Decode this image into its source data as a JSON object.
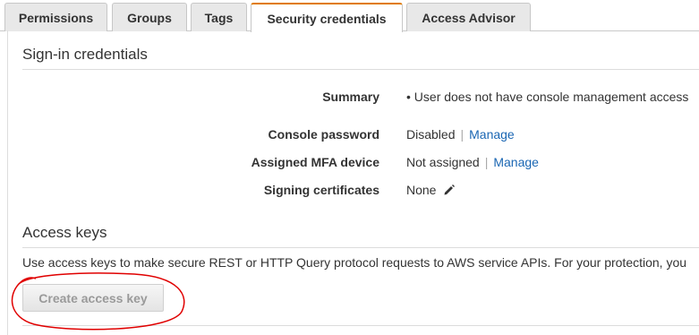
{
  "tabs": [
    {
      "label": "Permissions"
    },
    {
      "label": "Groups"
    },
    {
      "label": "Tags"
    },
    {
      "label": "Security credentials"
    },
    {
      "label": "Access Advisor"
    }
  ],
  "signin": {
    "title": "Sign-in credentials",
    "summary_label": "Summary",
    "summary_value": "• User does not have console management access",
    "console_password_label": "Console password",
    "console_password_value": "Disabled",
    "assigned_mfa_label": "Assigned MFA device",
    "assigned_mfa_value": "Not assigned",
    "signing_certs_label": "Signing certificates",
    "signing_certs_value": "None",
    "manage_link": "Manage",
    "separator": "|"
  },
  "access_keys": {
    "title": "Access keys",
    "description": "Use access keys to make secure REST or HTTP Query protocol requests to AWS service APIs. For your protection, you",
    "create_button": "Create access key"
  },
  "colors": {
    "active_tab_accent": "#e07b00",
    "link": "#1a66b3",
    "annotation": "#e00000"
  },
  "icons": {
    "edit": "pencil-icon"
  }
}
